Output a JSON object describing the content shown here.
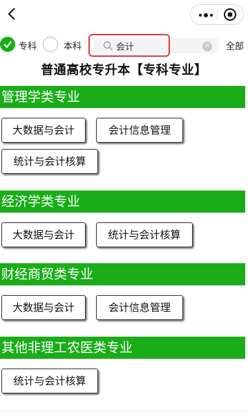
{
  "nav": {
    "back_icon": "chevron-left-icon",
    "more_icon": "more-dots-icon",
    "close_icon": "target-circle-icon"
  },
  "filter": {
    "option_specialty": "专科",
    "option_bachelor": "本科",
    "selected": "专科",
    "search_value": "会计",
    "all_label": "全部",
    "accent": "#1aad19",
    "highlight_border": "#e23a3a"
  },
  "page_title": "普通高校专升本【专科专业】",
  "sections": [
    {
      "header": "管理学类专业",
      "majors": [
        "大数据与会计",
        "会计信息管理",
        "统计与会计核算"
      ]
    },
    {
      "header": "经济学类专业",
      "majors": [
        "大数据与会计",
        "统计与会计核算"
      ]
    },
    {
      "header": "财经商贸类专业",
      "majors": [
        "大数据与会计",
        "会计信息管理"
      ]
    },
    {
      "header": "其他非理工农医类专业",
      "majors": [
        "统计与会计核算"
      ]
    }
  ]
}
